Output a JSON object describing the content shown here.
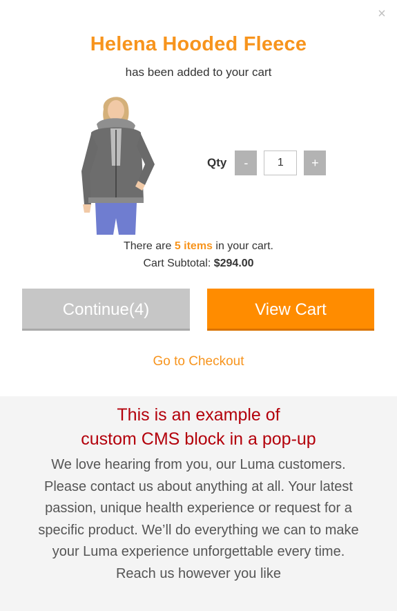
{
  "modal": {
    "close_label": "×",
    "product_name": "Helena Hooded Fleece",
    "added_message": "has been added to your cart",
    "qty": {
      "label": "Qty",
      "minus": "-",
      "value": "1",
      "plus": "+"
    },
    "cart": {
      "prefix": "There are ",
      "items": "5 items",
      "suffix": " in your cart.",
      "subtotal_label": "Cart Subtotal: ",
      "subtotal_value": "$294.00"
    },
    "buttons": {
      "continue": "Continue(4)",
      "view_cart": "View Cart"
    },
    "checkout_link": "Go to Checkout"
  },
  "cms": {
    "title_line1": "This is an example of",
    "title_line2": "custom CMS block in a pop-up",
    "body": "We love hearing from you, our Luma customers. Please contact us about anything at all. Your latest passion, unique health experience or request for a specific product. We’ll do everything we can to make your Luma experience unforgettable every time. Reach us however you like"
  },
  "colors": {
    "accent": "#f7941d",
    "view_cart_bg": "#ff8c00",
    "continue_bg": "#c6c6c6",
    "cms_title": "#b3000b",
    "cms_bg": "#f4f4f4"
  }
}
